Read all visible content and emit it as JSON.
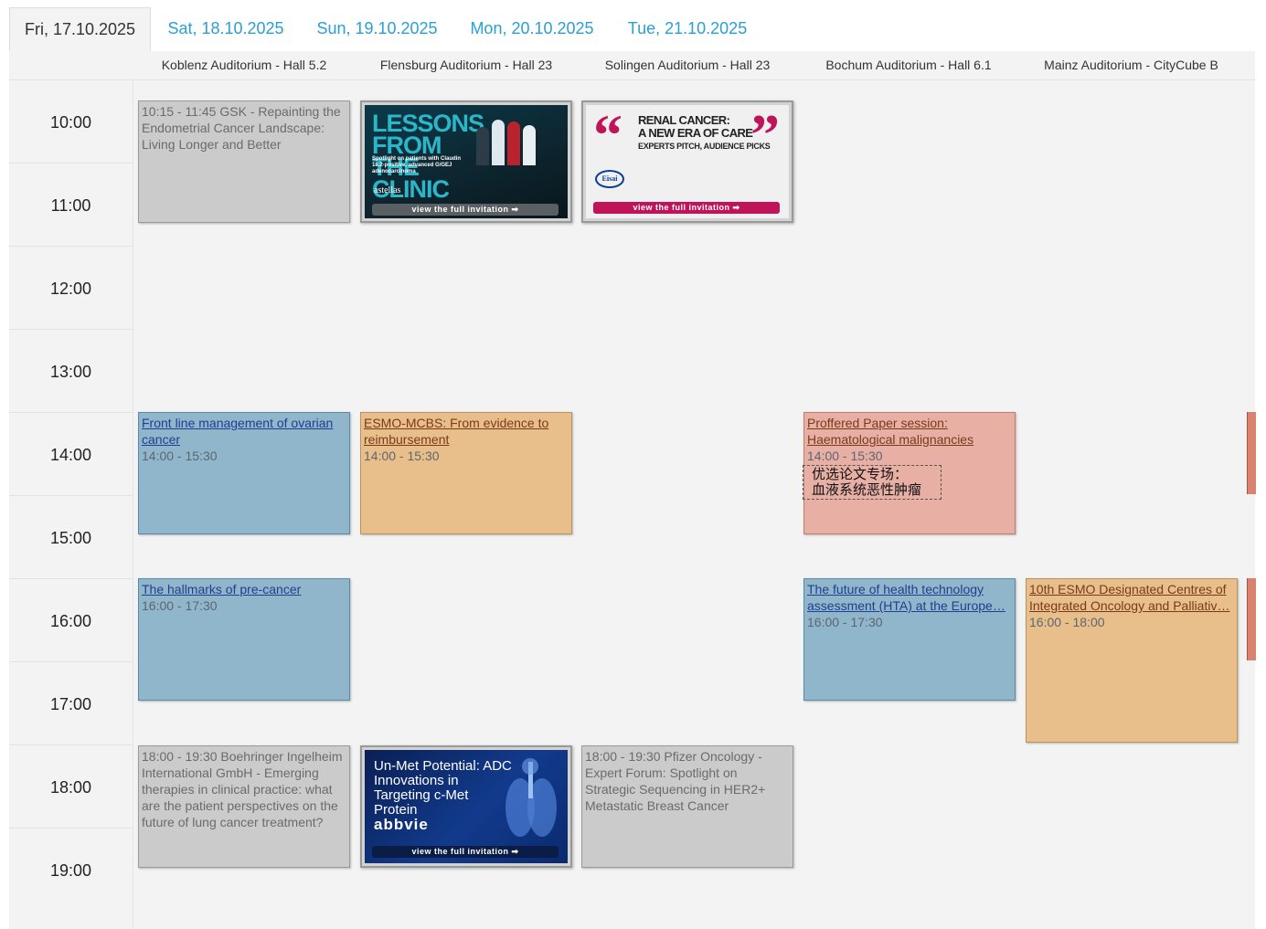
{
  "days": [
    {
      "label": "Fri, 17.10.2025",
      "active": true
    },
    {
      "label": "Sat, 18.10.2025",
      "active": false
    },
    {
      "label": "Sun, 19.10.2025",
      "active": false
    },
    {
      "label": "Mon, 20.10.2025",
      "active": false
    },
    {
      "label": "Tue, 21.10.2025",
      "active": false
    }
  ],
  "rooms": [
    "Koblenz Auditorium - Hall 5.2",
    "Flensburg Auditorium - Hall 23",
    "Solingen Auditorium - Hall 23",
    "Bochum Auditorium - Hall 6.1",
    "Mainz Auditorium - CityCube B"
  ],
  "times": [
    "10:00",
    "11:00",
    "12:00",
    "13:00",
    "14:00",
    "15:00",
    "16:00",
    "17:00",
    "18:00",
    "19:00"
  ],
  "events": {
    "gsk": {
      "text": "10:15 - 11:45 GSK - Repainting the Endometrial Cancer Landscape: Living Longer and Better"
    },
    "astellas": {
      "title": "LESSONS FROM THE CLINIC",
      "subtitle": "Spotlight on patients with Claudin 18.2-positive, advanced G/GEJ adenocarcinoma",
      "brand": "astellas",
      "cta": "view the full invitation"
    },
    "eisai": {
      "title_line1": "RENAL CANCER:",
      "title_line2": "A NEW ERA OF CARE",
      "title_line3": "EXPERTS PITCH, AUDIENCE PICKS",
      "brand": "Eisai",
      "cta": "view the full invitation"
    },
    "ovarian": {
      "title": "Front line management of ovarian cancer",
      "time": "14:00 - 15:30"
    },
    "mcbs": {
      "title": "ESMO-MCBS: From evidence to reimbursement",
      "time": "14:00 - 15:30"
    },
    "proffered": {
      "title": "Proffered Paper session: Haematological malignancies",
      "time": "14:00 - 15:30",
      "annotation_line1": "优选论文专场：",
      "annotation_line2": "血液系统恶性肿瘤"
    },
    "precancer": {
      "title": "The hallmarks of pre-cancer",
      "time": "16:00 - 17:30"
    },
    "hta": {
      "title_line1": "The future of health technology",
      "title_line2": "assessment (HTA) at the Europe…",
      "time": "16:00 - 17:30"
    },
    "esmo_centres": {
      "title_line1": "10th ESMO Designated Centres of",
      "title_line2": "Integrated Oncology and Palliativ…",
      "time": "16:00 - 18:00"
    },
    "boehringer": {
      "text": "18:00 - 19:30 Boehringer Ingelheim International GmbH - Emerging therapies in clinical practice: what are the patient perspectives on the future of lung cancer treatment?"
    },
    "abbvie": {
      "title": "Un-Met Potential: ADC Innovations in Targeting c-Met Protein",
      "brand": "abbvie",
      "cta": "view the full invitation"
    },
    "pfizer": {
      "text": "18:00 - 19:30 Pfizer Oncology - Expert Forum: Spotlight on Strategic Sequencing in HER2+ Metastatic Breast Cancer"
    }
  },
  "colors": {
    "tab_link": "#2a9fd6",
    "gray_event": "#cbcbcb",
    "blue_event": "#8fb6cb",
    "orange_event": "#e8bf8b",
    "red_event": "#e8afa5",
    "eisai_magenta": "#c0145a"
  }
}
